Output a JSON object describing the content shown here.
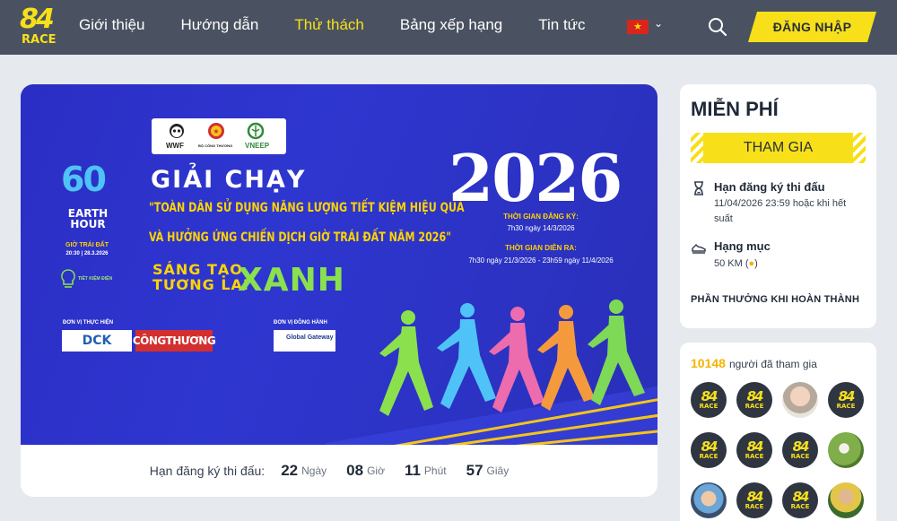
{
  "nav": {
    "logo_top": "84",
    "logo_bottom": "RACE",
    "items": [
      {
        "label": "Giới thiệu",
        "active": false
      },
      {
        "label": "Hướng dẫn",
        "active": false
      },
      {
        "label": "Thử thách",
        "active": true
      },
      {
        "label": "Bảng xếp hạng",
        "active": false
      },
      {
        "label": "Tin tức",
        "active": false
      }
    ],
    "language_flag": "vietnam-flag-icon",
    "login_label": "ĐĂNG NHẬP",
    "accent_color": "#f7e01a",
    "bar_color": "#4a5261"
  },
  "banner": {
    "partners": [
      "WWF",
      "BỘ CÔNG THƯƠNG",
      "VNEEP"
    ],
    "earth_hour_number": "60",
    "earth_hour_text": "EARTH HOUR",
    "earth_hour_vi": "GIỜ TRÁI ĐẤT",
    "earth_hour_date": "20:30 | 28.3.2026",
    "tiet_kiem": "TIẾT KIỆM ĐIỆN",
    "title": "GIẢI CHẠY",
    "subtitle_line1": "\"TOÀN DÂN SỬ DỤNG NĂNG LƯỢNG TIẾT KIỆM HIỆU QUẢ",
    "subtitle_line2": "VÀ HƯỞNG ỨNG CHIẾN DỊCH GIỜ TRÁI ĐẤT NĂM 2026\"",
    "slogan_line1": "SÁNG TẠO",
    "slogan_line2": "TƯƠNG LAI",
    "slogan_big": "XANH",
    "year": "2026",
    "reg_time_label": "THỜI GIAN ĐĂNG KÝ:",
    "reg_time_value": "7h30 ngày 14/3/2026",
    "run_time_label": "THỜI GIAN DIỄN RA:",
    "run_time_value": "7h30 ngày 21/3/2026 - 23h59 ngày 11/4/2026",
    "organizer_label": "ĐƠN VỊ THỰC HIỆN",
    "companion_label": "ĐƠN VỊ ĐỒNG HÀNH",
    "org1": "DCK",
    "org2": "CÔNGTHƯƠNG",
    "companion1": "Global Gateway"
  },
  "countdown": {
    "label": "Hạn đăng ký thi đấu:",
    "days": "22",
    "days_unit": "Ngày",
    "hours": "08",
    "hours_unit": "Giờ",
    "minutes": "11",
    "minutes_unit": "Phút",
    "seconds": "57",
    "seconds_unit": "Giây"
  },
  "sidebar": {
    "price": "MIỄN PHÍ",
    "join_label": "THAM GIA",
    "deadline_title": "Hạn đăng ký thi đấu",
    "deadline_text": "11/04/2026 23:59 hoặc khi hết suất",
    "category_title": "Hạng mục",
    "category_text": "50 KM (",
    "category_suffix": ")",
    "reward_label": "PHẦN THƯỞNG KHI HOÀN THÀNH",
    "participants_count": "10148",
    "participants_text": "người đã tham gia",
    "avatars": [
      "logo",
      "logo",
      "photo1",
      "logo",
      "logo",
      "logo",
      "logo",
      "photo2",
      "photo3",
      "logo",
      "logo",
      "photo4"
    ]
  }
}
